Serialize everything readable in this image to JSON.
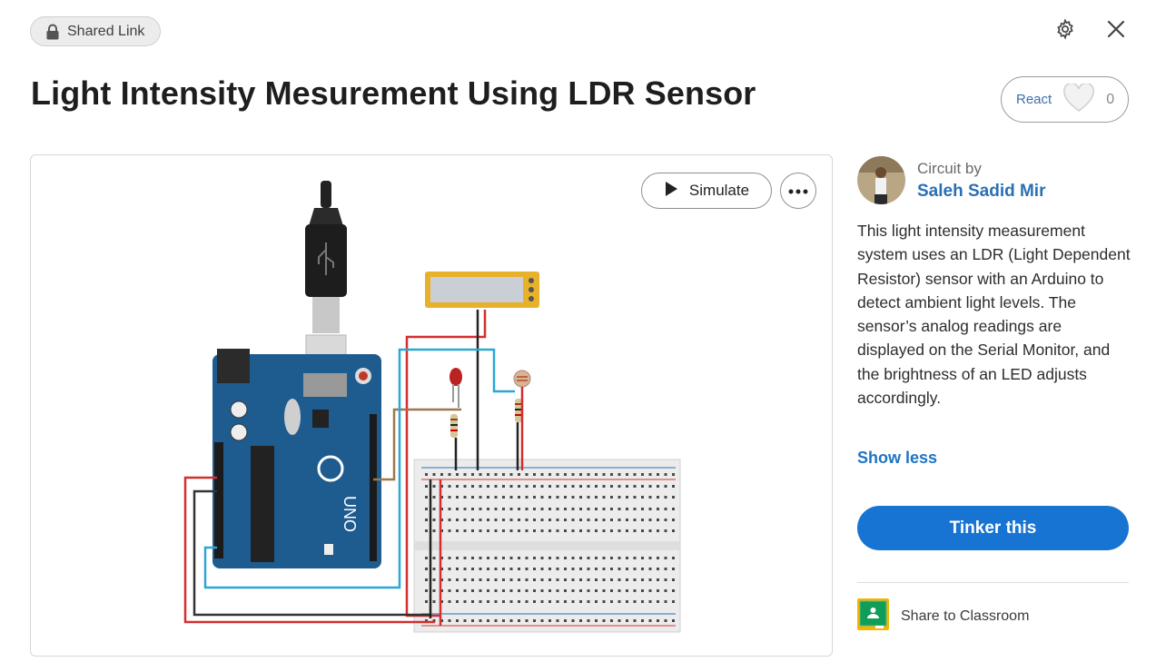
{
  "header": {
    "shared_label": "Shared Link"
  },
  "project": {
    "title": "Light Intensity Mesurement Using LDR Sensor"
  },
  "react": {
    "label": "React",
    "count": "0"
  },
  "canvas": {
    "simulate_label": "Simulate"
  },
  "sidebar": {
    "circuit_by": "Circuit by",
    "author": "Saleh Sadid Mir",
    "description": "This light intensity measurement system uses an LDR (Light Dependent Resistor) sensor with an Arduino to detect ambient light levels. The sensor’s analog readings are displayed on the Serial Monitor, and the brightness of an LED adjusts accordingly.",
    "show_less": "Show less",
    "tinker_label": "Tinker this",
    "share_classroom": "Share to Classroom"
  },
  "colors": {
    "accent": "#1874d2",
    "link": "#2a6fb5",
    "arduino": "#1e5b8f",
    "wire_red": "#d32f2f",
    "wire_blue": "#2aa7d6"
  },
  "icons": [
    "lock-icon",
    "gear-icon",
    "close-icon",
    "heart-icon",
    "play-icon",
    "more-icon",
    "google-classroom-icon"
  ]
}
